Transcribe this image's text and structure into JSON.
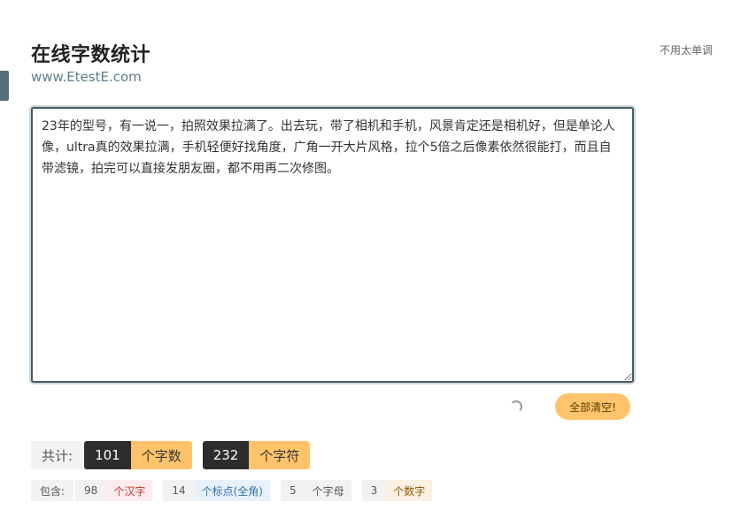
{
  "header": {
    "title": "在线字数统计",
    "subtitle": "www.EtestE.com",
    "theme_link": "不用太单调"
  },
  "editor": {
    "text": "23年的型号，有一说一，拍照效果拉满了。出去玩，带了相机和手机，风景肯定还是相机好，但是单论人像，ultra真的效果拉满，手机轻便好找角度，广角一开大片风格，拉个5倍之后像素依然很能打，而且自带滤镜，拍完可以直接发朋友圈，都不用再二次修图。"
  },
  "actions": {
    "clear_label": "全部清空!"
  },
  "totals": {
    "label": "共计:",
    "word_count": "101",
    "word_unit": "个字数",
    "char_count": "232",
    "char_unit": "个字符"
  },
  "breakdown": {
    "label": "包含:",
    "hanzi_count": "98",
    "hanzi_unit": "个汉字",
    "punct_count": "14",
    "punct_unit": "个标点(全角)",
    "letter_count": "5",
    "letter_unit": "个字母",
    "digit_count": "3",
    "digit_unit": "个数字"
  },
  "colors": {
    "accent": "#ffc46b",
    "dark": "#2d2d2d",
    "border": "#455a64"
  }
}
